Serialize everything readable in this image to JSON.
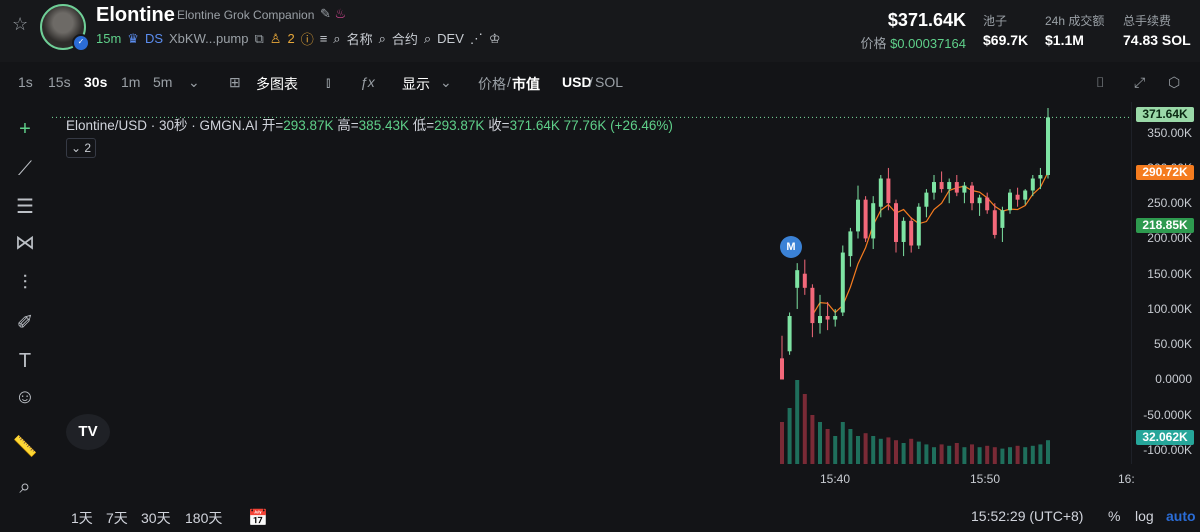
{
  "header": {
    "title": "Elontine",
    "subtitle": "Elontine Grok Companion",
    "age": "15m",
    "ds_label": "DS",
    "address": "XbKW...pump",
    "holders_count": "2",
    "links": [
      "名称",
      "合约",
      "DEV"
    ],
    "market_cap": "$371.64K",
    "price_label": "价格",
    "price_value": "$0.00037164",
    "stats": [
      {
        "label": "池子",
        "value": "$69.7K"
      },
      {
        "label": "24h 成交额",
        "value": "$1.1M"
      },
      {
        "label": "总手续费",
        "value": "74.83 SOL"
      }
    ]
  },
  "toolbar": {
    "intervals": [
      "1s",
      "15s",
      "30s",
      "1m",
      "5m"
    ],
    "active_interval": "30s",
    "multi_chart": "多图表",
    "display": "显示",
    "price_toggle": "价格",
    "mcap_toggle": "市值",
    "usd_toggle": "USD",
    "sol_toggle": "SOL"
  },
  "legend": {
    "symbol": "Elontine/USD · 30秒 · GMGN.AI",
    "open_label": "开=",
    "open": "293.87K",
    "high_label": "高=",
    "high": "385.43K",
    "low_label": "低=",
    "low": "293.87K",
    "close_label": "收=",
    "close": "371.64K",
    "change": "77.76K (+26.46%)",
    "indicator_count": "2"
  },
  "axis": {
    "price_ticks": [
      "350.00K",
      "300.00K",
      "250.00K",
      "200.00K",
      "150.00K",
      "100.00K",
      "50.00K",
      "0.0000",
      "-50.000K",
      "-100.00K"
    ],
    "time_ticks": [
      "15:40",
      "15:50",
      "16:"
    ],
    "tags": [
      {
        "value": "371.64K",
        "color": "#9ad9a8"
      },
      {
        "value": "290.72K",
        "color": "#f57c1f"
      },
      {
        "value": "218.85K",
        "color": "#2e9a4f"
      },
      {
        "value": "32.062K",
        "color": "#26a69a"
      }
    ]
  },
  "marker": "M",
  "logo": "TV",
  "bottom": {
    "ranges": [
      "1天",
      "7天",
      "30天",
      "180天"
    ],
    "clock": "15:52:29 (UTC+8)",
    "percent": "%",
    "log": "log",
    "auto": "auto"
  },
  "chart_data": {
    "type": "candlestick",
    "candles": [
      {
        "o": 30,
        "h": 62,
        "l": 0,
        "c": 0
      },
      {
        "o": 40,
        "h": 95,
        "l": 35,
        "c": 90
      },
      {
        "o": 130,
        "h": 165,
        "l": 100,
        "c": 155
      },
      {
        "o": 150,
        "h": 170,
        "l": 120,
        "c": 130
      },
      {
        "o": 130,
        "h": 135,
        "l": 60,
        "c": 80
      },
      {
        "o": 80,
        "h": 120,
        "l": 65,
        "c": 90
      },
      {
        "o": 90,
        "h": 110,
        "l": 70,
        "c": 85
      },
      {
        "o": 85,
        "h": 100,
        "l": 75,
        "c": 90
      },
      {
        "o": 95,
        "h": 190,
        "l": 90,
        "c": 180
      },
      {
        "o": 175,
        "h": 215,
        "l": 160,
        "c": 210
      },
      {
        "o": 210,
        "h": 275,
        "l": 200,
        "c": 255
      },
      {
        "o": 255,
        "h": 260,
        "l": 195,
        "c": 200
      },
      {
        "o": 200,
        "h": 260,
        "l": 185,
        "c": 250
      },
      {
        "o": 245,
        "h": 290,
        "l": 230,
        "c": 285
      },
      {
        "o": 285,
        "h": 300,
        "l": 240,
        "c": 250
      },
      {
        "o": 250,
        "h": 255,
        "l": 180,
        "c": 195
      },
      {
        "o": 195,
        "h": 230,
        "l": 175,
        "c": 225
      },
      {
        "o": 225,
        "h": 230,
        "l": 180,
        "c": 190
      },
      {
        "o": 190,
        "h": 250,
        "l": 185,
        "c": 245
      },
      {
        "o": 245,
        "h": 270,
        "l": 230,
        "c": 265
      },
      {
        "o": 265,
        "h": 290,
        "l": 255,
        "c": 280
      },
      {
        "o": 280,
        "h": 295,
        "l": 265,
        "c": 270
      },
      {
        "o": 270,
        "h": 285,
        "l": 250,
        "c": 280
      },
      {
        "o": 280,
        "h": 290,
        "l": 260,
        "c": 265
      },
      {
        "o": 265,
        "h": 280,
        "l": 250,
        "c": 275
      },
      {
        "o": 275,
        "h": 280,
        "l": 240,
        "c": 250
      },
      {
        "o": 250,
        "h": 262,
        "l": 232,
        "c": 258
      },
      {
        "o": 258,
        "h": 265,
        "l": 235,
        "c": 240
      },
      {
        "o": 240,
        "h": 250,
        "l": 200,
        "c": 205
      },
      {
        "o": 215,
        "h": 245,
        "l": 195,
        "c": 240
      },
      {
        "o": 240,
        "h": 270,
        "l": 235,
        "c": 265
      },
      {
        "o": 262,
        "h": 272,
        "l": 245,
        "c": 255
      },
      {
        "o": 255,
        "h": 270,
        "l": 248,
        "c": 268
      },
      {
        "o": 268,
        "h": 290,
        "l": 260,
        "c": 285
      },
      {
        "o": 285,
        "h": 300,
        "l": 270,
        "c": 290
      },
      {
        "o": 290,
        "h": 385,
        "l": 285,
        "c": 371.64
      }
    ],
    "volume": [
      30,
      40,
      60,
      50,
      35,
      30,
      25,
      20,
      30,
      25,
      20,
      22,
      20,
      18,
      19,
      17,
      15,
      18,
      16,
      14,
      12,
      14,
      13,
      15,
      12,
      14,
      12,
      13,
      12,
      11,
      12,
      13,
      12,
      13,
      14,
      17
    ],
    "ylim": [
      -100,
      385
    ],
    "grid": false
  }
}
